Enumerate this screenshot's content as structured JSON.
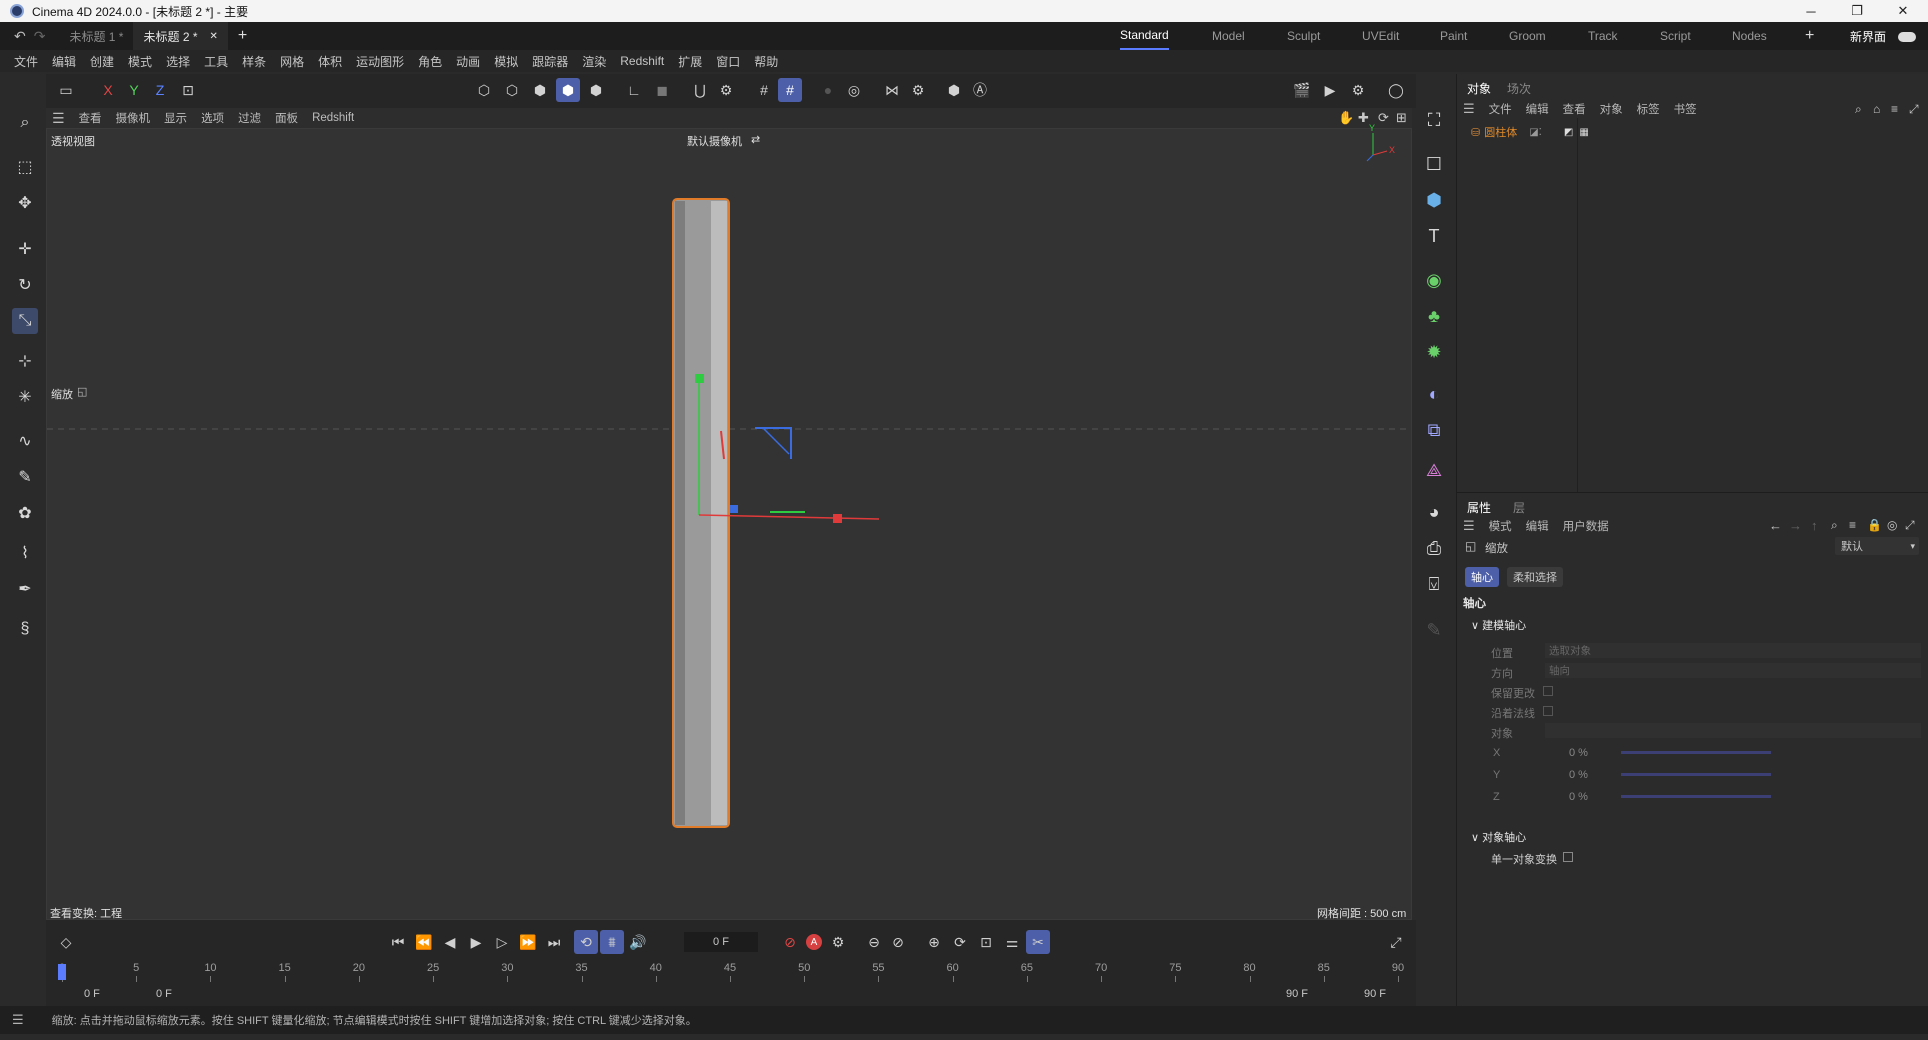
{
  "window": {
    "title": "Cinema 4D 2024.0.0 - [未标题 2 *] - 主要",
    "min": "─",
    "max": "❐",
    "close": "✕"
  },
  "doc_tabs": [
    "未标题 1 *",
    "未标题 2 *"
  ],
  "tab_close": "✕",
  "tab_add": "+",
  "layouts": [
    "Standard",
    "Model",
    "Sculpt",
    "UVEdit",
    "Paint",
    "Groom",
    "Track",
    "Script",
    "Nodes"
  ],
  "layout_add": "+",
  "new_interface": "新界面",
  "menu": [
    "文件",
    "编辑",
    "创建",
    "模式",
    "选择",
    "工具",
    "样条",
    "网格",
    "体积",
    "运动图形",
    "角色",
    "动画",
    "模拟",
    "跟踪器",
    "渲染",
    "Redshift",
    "扩展",
    "窗口",
    "帮助"
  ],
  "axis_lock": {
    "x": "X",
    "y": "Y",
    "z": "Z"
  },
  "viewport_menu": [
    "查看",
    "摄像机",
    "显示",
    "选项",
    "过滤",
    "面板",
    "Redshift"
  ],
  "viewport": {
    "name": "透视视图",
    "camera": "默认摄像机",
    "scale_label": "缩放",
    "view_transform": "查看变换: 工程",
    "grid_spacing": "网格间距 : 500 cm",
    "axis_y": "Y",
    "axis_x": "X"
  },
  "object_panel": {
    "tabs": [
      "对象",
      "场次"
    ],
    "menu": [
      "文件",
      "编辑",
      "查看",
      "对象",
      "标签",
      "书签"
    ],
    "objects": [
      {
        "name": "圆柱体"
      }
    ]
  },
  "attr_panel": {
    "tabs": [
      "属性",
      "层"
    ],
    "menu": [
      "模式",
      "编辑",
      "用户数据"
    ],
    "tool_name": "缩放",
    "preset": "默认",
    "sub_tabs": [
      "轴心",
      "柔和选择"
    ],
    "section": "轴心",
    "group1": "建模轴心",
    "position_label": "位置",
    "position_value": "选取对象",
    "direction_label": "方向",
    "direction_value": "轴向",
    "keep_changes": "保留更改",
    "along_normal": "沿着法线",
    "object_label": "对象",
    "x_label": "X",
    "x_value": "0 %",
    "y_label": "Y",
    "y_value": "0 %",
    "z_label": "Z",
    "z_value": "0 %",
    "group2": "对象轴心",
    "single_transform": "单一对象变换"
  },
  "timeline": {
    "current_frame": "0 F",
    "start": "0 F",
    "start2": "0 F",
    "end": "90 F",
    "end2": "90 F",
    "ticks": [
      "0",
      "5",
      "10",
      "15",
      "20",
      "25",
      "30",
      "35",
      "40",
      "45",
      "50",
      "55",
      "60",
      "65",
      "70",
      "75",
      "80",
      "85",
      "90"
    ],
    "record_label": "A"
  },
  "status_text": "缩放: 点击并拖动鼠标缩放元素。按住 SHIFT 键量化缩放; 节点编辑模式时按住 SHIFT 键增加选择对象; 按住 CTRL 键减少选择对象。",
  "colors": {
    "accent": "#5b7cff",
    "selection": "#e07b2a",
    "x_axis": "#e03a3a",
    "y_axis": "#2ecc40",
    "z_axis": "#3a6ce0"
  }
}
